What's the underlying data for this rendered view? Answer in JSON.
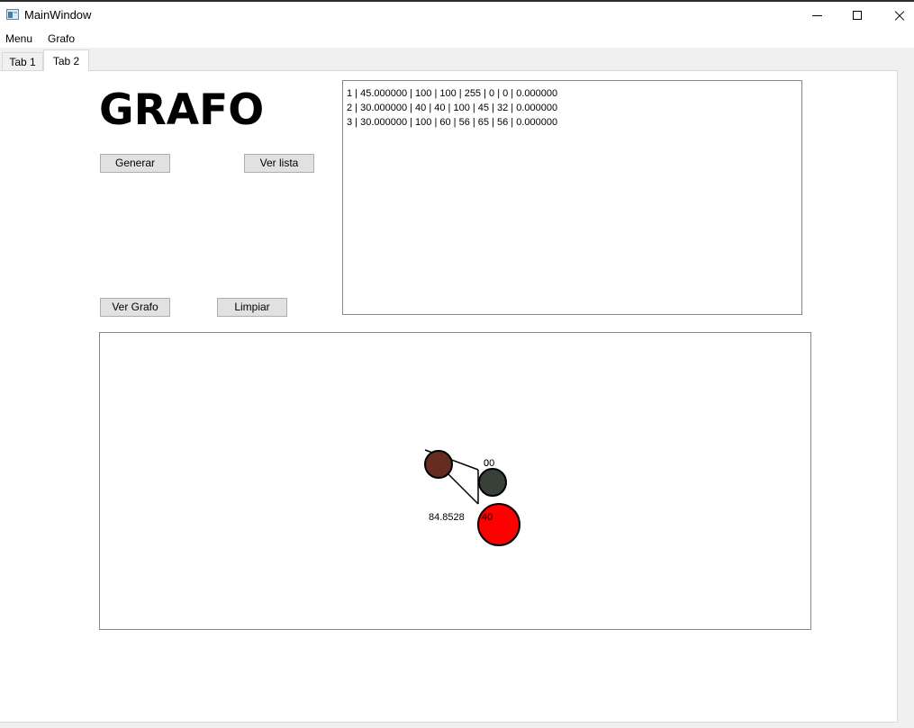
{
  "window": {
    "title": "MainWindow"
  },
  "menubar": {
    "items": [
      "Menu",
      "Grafo"
    ]
  },
  "tabs": [
    {
      "label": "Tab 1",
      "selected": false
    },
    {
      "label": "Tab 2",
      "selected": true
    }
  ],
  "main": {
    "heading": "GRAFO",
    "buttons": {
      "generar": "Generar",
      "ver_lista": "Ver lista",
      "ver_grafo": "Ver Grafo",
      "limpiar": "Limpiar"
    },
    "list_lines": [
      "1 | 45.000000 | 100 | 100 | 255 | 0 | 0 | 0.000000",
      "2 | 30.000000 | 40 | 40 | 100 | 45 | 32 | 0.000000",
      "3 | 30.000000 | 100 | 60 | 56 | 65 | 56 | 0.000000"
    ]
  },
  "graph": {
    "nodes": [
      {
        "id": 1,
        "color": "#ff0000",
        "label": "40"
      },
      {
        "id": 2,
        "color": "#642d20",
        "label": ""
      },
      {
        "id": 3,
        "color": "#384138",
        "label": "00"
      }
    ],
    "edge_labels": {
      "node3_overlap": "0",
      "weight": "84.8528"
    }
  }
}
